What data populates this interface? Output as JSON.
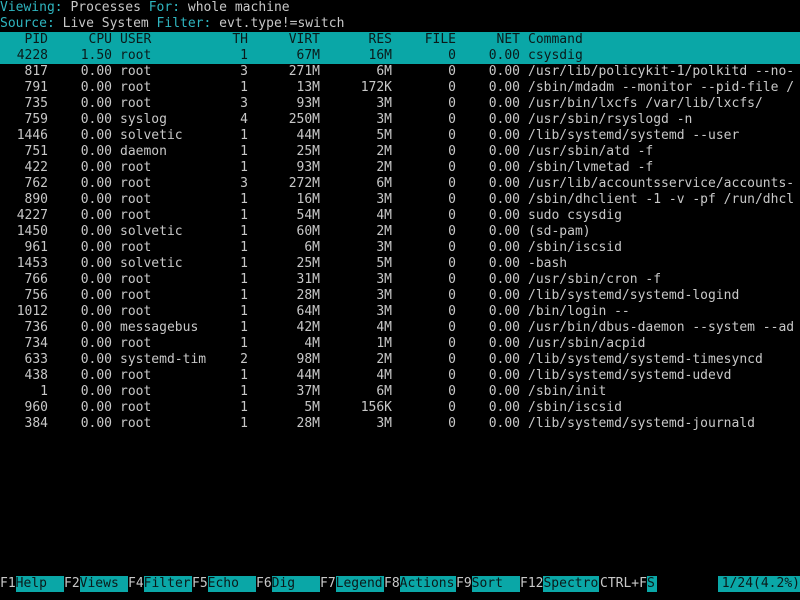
{
  "status": {
    "viewing_label": "Viewing:",
    "viewing_value": "Processes",
    "for_label": "For:",
    "for_value": "whole machine",
    "source_label": "Source:",
    "source_value": "Live System",
    "filter_label": "Filter:",
    "filter_value": "evt.type!=switch"
  },
  "columns": [
    "PID",
    "CPU",
    "USER",
    "TH",
    "VIRT",
    "RES",
    "FILE",
    "NET",
    "Command"
  ],
  "rows": [
    {
      "pid": "4228",
      "cpu": "1.50",
      "user": "root",
      "th": "1",
      "virt": "67M",
      "res": "16M",
      "file": "0",
      "net": "0.00",
      "cmd": "csysdig"
    },
    {
      "pid": "817",
      "cpu": "0.00",
      "user": "root",
      "th": "3",
      "virt": "271M",
      "res": "6M",
      "file": "0",
      "net": "0.00",
      "cmd": "/usr/lib/policykit-1/polkitd --no-"
    },
    {
      "pid": "791",
      "cpu": "0.00",
      "user": "root",
      "th": "1",
      "virt": "13M",
      "res": "172K",
      "file": "0",
      "net": "0.00",
      "cmd": "/sbin/mdadm --monitor --pid-file /"
    },
    {
      "pid": "735",
      "cpu": "0.00",
      "user": "root",
      "th": "3",
      "virt": "93M",
      "res": "3M",
      "file": "0",
      "net": "0.00",
      "cmd": "/usr/bin/lxcfs /var/lib/lxcfs/"
    },
    {
      "pid": "759",
      "cpu": "0.00",
      "user": "syslog",
      "th": "4",
      "virt": "250M",
      "res": "3M",
      "file": "0",
      "net": "0.00",
      "cmd": "/usr/sbin/rsyslogd -n"
    },
    {
      "pid": "1446",
      "cpu": "0.00",
      "user": "solvetic",
      "th": "1",
      "virt": "44M",
      "res": "5M",
      "file": "0",
      "net": "0.00",
      "cmd": "/lib/systemd/systemd --user"
    },
    {
      "pid": "751",
      "cpu": "0.00",
      "user": "daemon",
      "th": "1",
      "virt": "25M",
      "res": "2M",
      "file": "0",
      "net": "0.00",
      "cmd": "/usr/sbin/atd -f"
    },
    {
      "pid": "422",
      "cpu": "0.00",
      "user": "root",
      "th": "1",
      "virt": "93M",
      "res": "2M",
      "file": "0",
      "net": "0.00",
      "cmd": "/sbin/lvmetad -f"
    },
    {
      "pid": "762",
      "cpu": "0.00",
      "user": "root",
      "th": "3",
      "virt": "272M",
      "res": "6M",
      "file": "0",
      "net": "0.00",
      "cmd": "/usr/lib/accountsservice/accounts-"
    },
    {
      "pid": "890",
      "cpu": "0.00",
      "user": "root",
      "th": "1",
      "virt": "16M",
      "res": "3M",
      "file": "0",
      "net": "0.00",
      "cmd": "/sbin/dhclient -1 -v -pf /run/dhcl"
    },
    {
      "pid": "4227",
      "cpu": "0.00",
      "user": "root",
      "th": "1",
      "virt": "54M",
      "res": "4M",
      "file": "0",
      "net": "0.00",
      "cmd": "sudo csysdig"
    },
    {
      "pid": "1450",
      "cpu": "0.00",
      "user": "solvetic",
      "th": "1",
      "virt": "60M",
      "res": "2M",
      "file": "0",
      "net": "0.00",
      "cmd": "(sd-pam)"
    },
    {
      "pid": "961",
      "cpu": "0.00",
      "user": "root",
      "th": "1",
      "virt": "6M",
      "res": "3M",
      "file": "0",
      "net": "0.00",
      "cmd": "/sbin/iscsid"
    },
    {
      "pid": "1453",
      "cpu": "0.00",
      "user": "solvetic",
      "th": "1",
      "virt": "25M",
      "res": "5M",
      "file": "0",
      "net": "0.00",
      "cmd": "-bash"
    },
    {
      "pid": "766",
      "cpu": "0.00",
      "user": "root",
      "th": "1",
      "virt": "31M",
      "res": "3M",
      "file": "0",
      "net": "0.00",
      "cmd": "/usr/sbin/cron -f"
    },
    {
      "pid": "756",
      "cpu": "0.00",
      "user": "root",
      "th": "1",
      "virt": "28M",
      "res": "3M",
      "file": "0",
      "net": "0.00",
      "cmd": "/lib/systemd/systemd-logind"
    },
    {
      "pid": "1012",
      "cpu": "0.00",
      "user": "root",
      "th": "1",
      "virt": "64M",
      "res": "3M",
      "file": "0",
      "net": "0.00",
      "cmd": "/bin/login --"
    },
    {
      "pid": "736",
      "cpu": "0.00",
      "user": "messagebus",
      "th": "1",
      "virt": "42M",
      "res": "4M",
      "file": "0",
      "net": "0.00",
      "cmd": "/usr/bin/dbus-daemon --system --ad"
    },
    {
      "pid": "734",
      "cpu": "0.00",
      "user": "root",
      "th": "1",
      "virt": "4M",
      "res": "1M",
      "file": "0",
      "net": "0.00",
      "cmd": "/usr/sbin/acpid"
    },
    {
      "pid": "633",
      "cpu": "0.00",
      "user": "systemd-tim",
      "th": "2",
      "virt": "98M",
      "res": "2M",
      "file": "0",
      "net": "0.00",
      "cmd": "/lib/systemd/systemd-timesyncd"
    },
    {
      "pid": "438",
      "cpu": "0.00",
      "user": "root",
      "th": "1",
      "virt": "44M",
      "res": "4M",
      "file": "0",
      "net": "0.00",
      "cmd": "/lib/systemd/systemd-udevd"
    },
    {
      "pid": "1",
      "cpu": "0.00",
      "user": "root",
      "th": "1",
      "virt": "37M",
      "res": "6M",
      "file": "0",
      "net": "0.00",
      "cmd": "/sbin/init"
    },
    {
      "pid": "960",
      "cpu": "0.00",
      "user": "root",
      "th": "1",
      "virt": "5M",
      "res": "156K",
      "file": "0",
      "net": "0.00",
      "cmd": "/sbin/iscsid"
    },
    {
      "pid": "384",
      "cpu": "0.00",
      "user": "root",
      "th": "1",
      "virt": "28M",
      "res": "3M",
      "file": "0",
      "net": "0.00",
      "cmd": "/lib/systemd/systemd-journald"
    }
  ],
  "selected_index": 0,
  "footer": {
    "keys": [
      {
        "key": "F1",
        "label": "Help"
      },
      {
        "key": "F2",
        "label": "Views"
      },
      {
        "key": "F4",
        "label": "Filter"
      },
      {
        "key": "F5",
        "label": "Echo"
      },
      {
        "key": "F6",
        "label": "Dig"
      },
      {
        "key": "F7",
        "label": "Legend"
      },
      {
        "key": "F8",
        "label": "Actions"
      },
      {
        "key": "F9",
        "label": "Sort"
      },
      {
        "key": "F12",
        "label": "Spectro"
      }
    ],
    "hint": "CTRL+F",
    "hint_label": "S",
    "position": "1/24(4.2%)"
  },
  "colors": {
    "accent": "#0aa7a7",
    "label_cyan": "#2fb6c0",
    "text": "#c8c8c8",
    "background": "#000000"
  }
}
